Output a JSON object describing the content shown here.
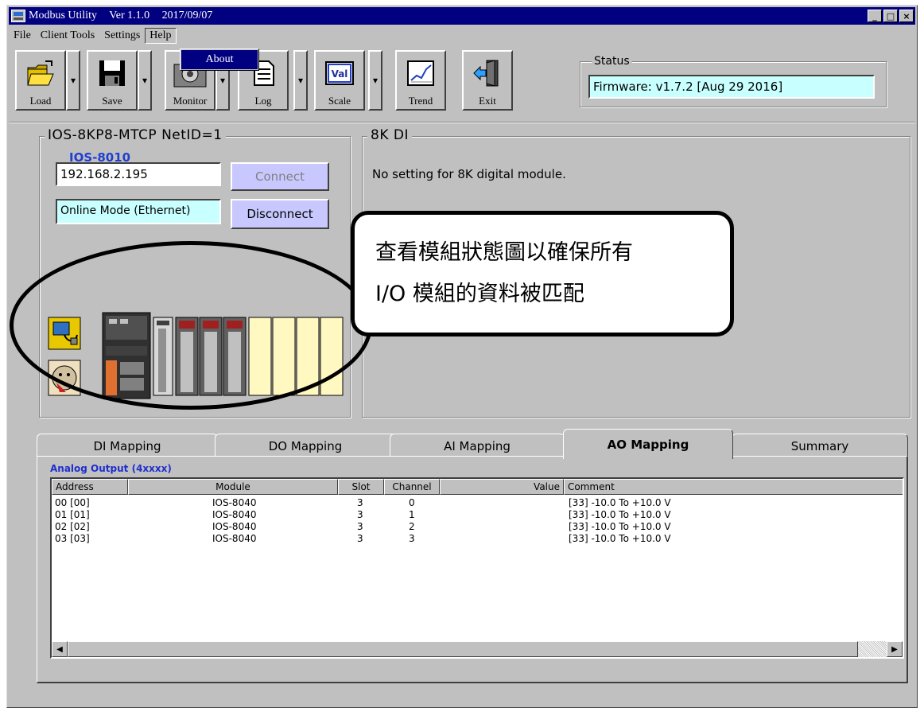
{
  "window": {
    "title_app": "Modbus Utility",
    "title_version": "Ver 1.1.0",
    "title_date": "2017/09/07",
    "caption": {
      "minimize": "_",
      "maximize": "□",
      "close": "×"
    }
  },
  "menu": {
    "items": [
      "File",
      "Client Tools",
      "Settings",
      "Help"
    ],
    "help_dropdown": "About"
  },
  "toolbar": {
    "load": "Load",
    "save": "Save",
    "monitor": "Monitor",
    "log": "Log",
    "scale": "Scale",
    "scale_icon_text": "Val",
    "trend": "Trend",
    "exit": "Exit"
  },
  "status": {
    "label": "Status",
    "value": "Firmware: v1.7.2 [Aug 29 2016]"
  },
  "device": {
    "group_title": "IOS-8KP8-MTCP  NetID=1",
    "ip": "192.168.2.195",
    "mode": "Online Mode (Ethernet)",
    "connect": "Connect",
    "disconnect": "Disconnect",
    "module_title": "IOS-8010"
  },
  "di8k": {
    "group_title": "8K DI",
    "message": "No setting for 8K digital module."
  },
  "callout": {
    "line1": "查看模組狀態圖以確保所有",
    "line2": "I/O 模組的資料被匹配"
  },
  "tabs": [
    "DI Mapping",
    "DO Mapping",
    "AI Mapping",
    "AO Mapping",
    "Summary"
  ],
  "panel": {
    "title": "Analog Output  (4xxxx)",
    "columns": [
      "Address",
      "Module",
      "Slot",
      "Channel",
      "Value",
      "Comment"
    ],
    "rows": [
      {
        "address": "00 [00]",
        "module": "IOS-8040",
        "slot": "3",
        "channel": "0",
        "value": "",
        "comment": "[33] -10.0 To +10.0 V"
      },
      {
        "address": "01 [01]",
        "module": "IOS-8040",
        "slot": "3",
        "channel": "1",
        "value": "",
        "comment": "[33] -10.0 To +10.0 V"
      },
      {
        "address": "02 [02]",
        "module": "IOS-8040",
        "slot": "3",
        "channel": "2",
        "value": "",
        "comment": "[33] -10.0 To +10.0 V"
      },
      {
        "address": "03 [03]",
        "module": "IOS-8040",
        "slot": "3",
        "channel": "3",
        "value": "",
        "comment": "[33] -10.0 To +10.0 V"
      }
    ]
  },
  "colors": {
    "titlebar": "#000080",
    "accent_blue_text": "#1f3fd0",
    "cyan_field": "#c8ffff",
    "purple_button": "#c8c8ff"
  }
}
